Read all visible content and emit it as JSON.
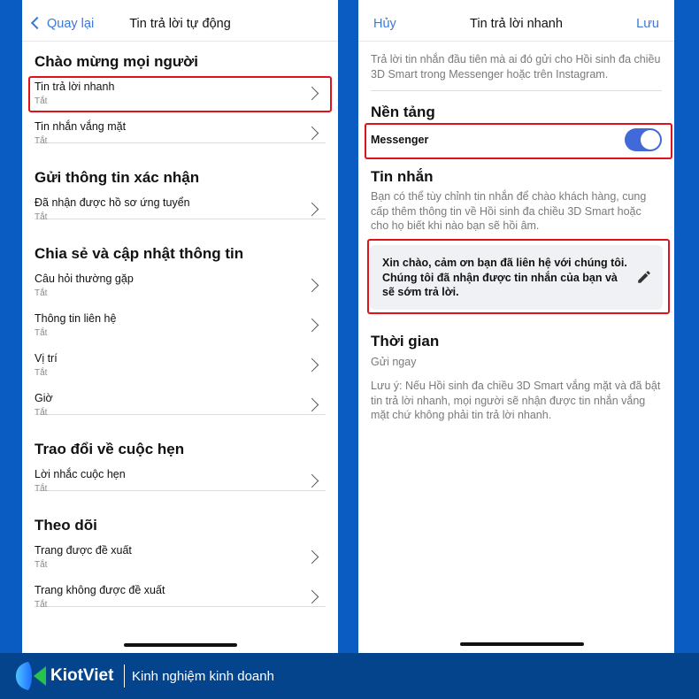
{
  "left": {
    "back_label": "Quay lại",
    "title": "Tin trả lời tự động",
    "sections": [
      {
        "heading": "Chào mừng mọi người",
        "items": [
          {
            "title": "Tin trả lời nhanh",
            "status": "Tắt"
          },
          {
            "title": "Tin nhắn vắng mặt",
            "status": "Tắt"
          }
        ]
      },
      {
        "heading": "Gửi thông tin xác nhận",
        "items": [
          {
            "title": "Đã nhận được hồ sơ ứng tuyển",
            "status": "Tắt"
          }
        ]
      },
      {
        "heading": "Chia sẻ và cập nhật thông tin",
        "items": [
          {
            "title": "Câu hỏi thường gặp",
            "status": "Tắt"
          },
          {
            "title": "Thông tin liên hệ",
            "status": "Tắt"
          },
          {
            "title": "Vị trí",
            "status": "Tắt"
          },
          {
            "title": "Giờ",
            "status": "Tắt"
          }
        ]
      },
      {
        "heading": "Trao đổi về cuộc hẹn",
        "items": [
          {
            "title": "Lời nhắc cuộc hẹn",
            "status": "Tắt"
          }
        ]
      },
      {
        "heading": "Theo dõi",
        "items": [
          {
            "title": "Trang được đề xuất",
            "status": "Tắt"
          },
          {
            "title": "Trang không được đề xuất",
            "status": "Tắt"
          }
        ]
      }
    ]
  },
  "right": {
    "cancel_label": "Hủy",
    "title": "Tin trả lời nhanh",
    "save_label": "Lưu",
    "description": "Trả lời tin nhắn đầu tiên mà ai đó gửi cho Hồi sinh đa chiều 3D Smart trong Messenger hoặc trên Instagram.",
    "platform_heading": "Nền tảng",
    "platform_label": "Messenger",
    "platform_enabled": true,
    "message_heading": "Tin nhắn",
    "message_description": "Bạn có thể tùy chỉnh tin nhắn để chào khách hàng, cung cấp thêm thông tin về Hồi sinh đa chiều 3D Smart hoặc cho họ biết khi nào bạn sẽ hồi âm.",
    "message_text": "Xin chào, cảm ơn bạn đã liên hệ với chúng tôi. Chúng tôi đã nhận được tin nhắn của bạn và sẽ sớm trả lời.",
    "time_heading": "Thời gian",
    "time_value": "Gửi ngay",
    "note": "Lưu ý: Nếu Hồi sinh đa chiều 3D Smart vắng mặt và đã bật tin trả lời nhanh, mọi người sẽ nhận được tin nhắn vắng mặt chứ không phải tin trả lời nhanh."
  },
  "footer": {
    "brand": "KiotViet",
    "tagline": "Kinh nghiệm kinh doanh"
  },
  "colors": {
    "background": "#0a5cc2",
    "footer": "#04448c",
    "accent": "#3b78d8",
    "highlight": "#e0121c",
    "toggle": "#4169d8"
  }
}
